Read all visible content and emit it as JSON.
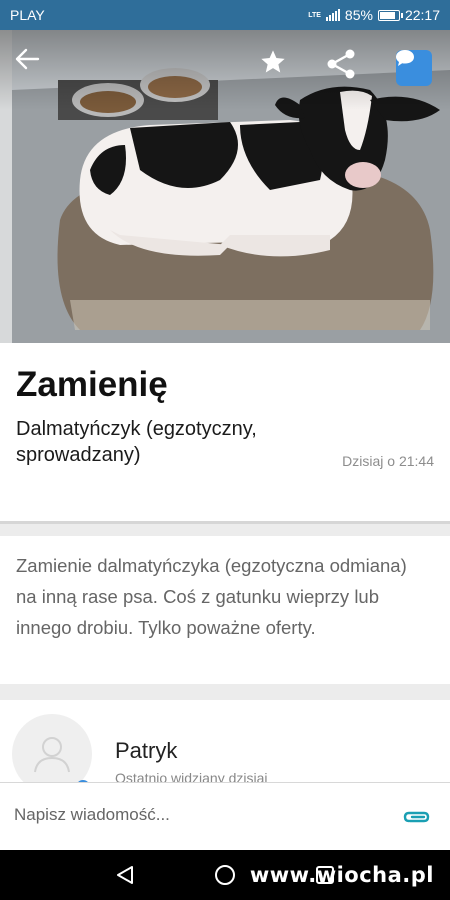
{
  "status_bar": {
    "carrier": "PLAY",
    "network": "LTE",
    "battery": "85%",
    "battery_level": 0.85,
    "time": "22:17"
  },
  "toolbar": {
    "back_icon": "arrow-left-icon",
    "favorite_icon": "star-icon",
    "share_icon": "share-icon",
    "chat_icon": "chat-bubble-icon"
  },
  "listing": {
    "title": "Zamienię",
    "subtitle": "Dalmatyńczyk (egzotyczny, sprowadzany)",
    "posted": "Dzisiaj o 21:44",
    "description": "Zamienie dalmatyńczyka (egzotyczna odmiana) na inną rase psa. Coś z gatunku wieprzy lub innego drobiu. Tylko poważne oferty."
  },
  "seller": {
    "name": "Patryk",
    "last_seen": "Ostatnio widziany dzisiaj"
  },
  "message": {
    "placeholder": "Napisz wiadomość..."
  },
  "nav": {
    "back_icon": "triangle-back-icon",
    "home_icon": "circle-home-icon",
    "recents_icon": "square-recents-icon"
  },
  "watermark": "www.wiocha.pl",
  "colors": {
    "status_bar": "#2f6e9a",
    "accent": "#3a8ede"
  }
}
